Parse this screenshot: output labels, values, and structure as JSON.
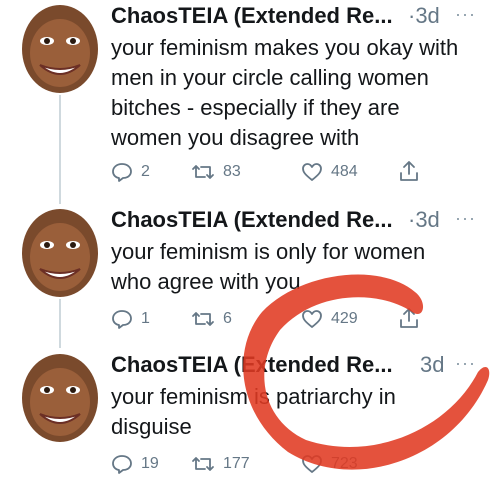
{
  "tweets": [
    {
      "author": "ChaosTEIA (Extended Re...",
      "time": "·3d",
      "lines": [
        "your feminism makes you okay with",
        "men in your circle calling women",
        "bitches - especially if they are",
        "women you disagree with"
      ],
      "replies": "2",
      "retweets": "83",
      "likes": "484"
    },
    {
      "author": "ChaosTEIA (Extended Re...",
      "time": "·3d",
      "lines": [
        "your feminism is only for women",
        "who agree with you"
      ],
      "replies": "1",
      "retweets": "6",
      "likes": "429"
    },
    {
      "author": "ChaosTEIA (Extended Re...",
      "time": "3d",
      "lines": [
        "your feminism is patriarchy in",
        "disguise"
      ],
      "replies": "19",
      "retweets": "177",
      "likes": "723"
    }
  ],
  "icons": {
    "more": "more-options-icon",
    "reply": "reply-icon",
    "retweet": "retweet-icon",
    "like": "like-icon",
    "share": "share-icon",
    "more_glyph": "···"
  },
  "colors": {
    "text": "#14171a",
    "muted": "#657786",
    "thread_line": "#cfd9de",
    "scribble": "#e03a22"
  }
}
